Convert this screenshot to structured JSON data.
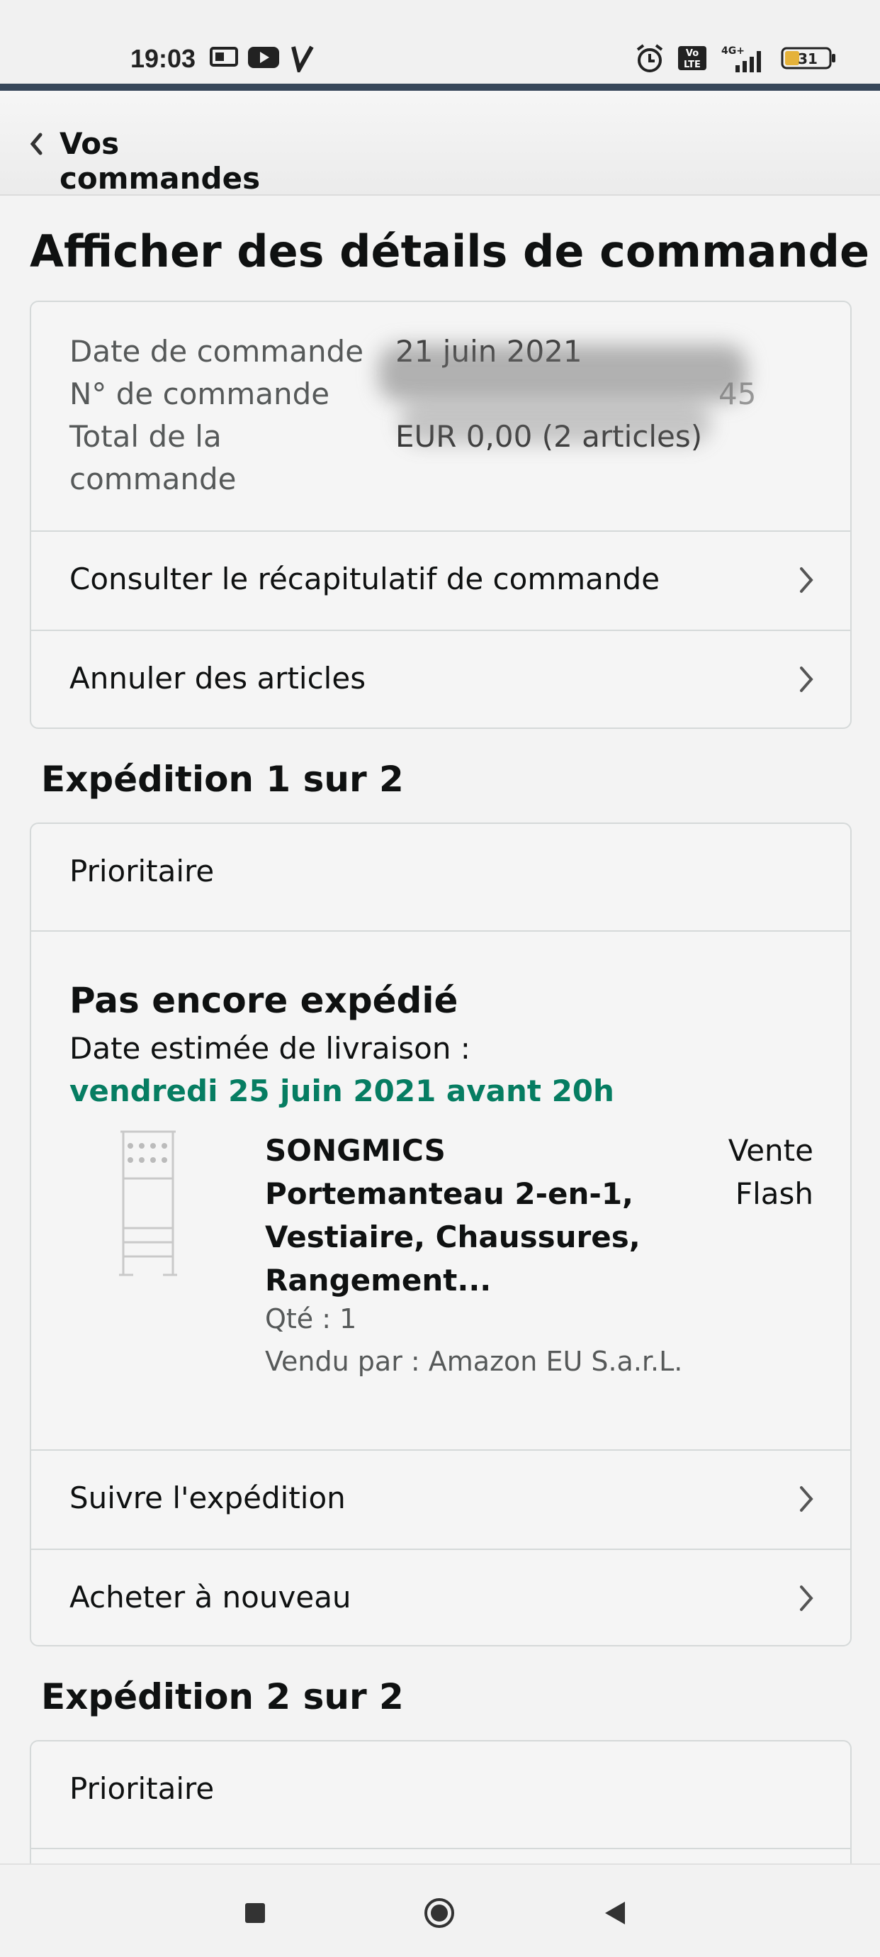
{
  "status_bar": {
    "time": "19:03",
    "battery": "31",
    "network": "4G+"
  },
  "header": {
    "back_label": "Vos commandes"
  },
  "page_title": "Afficher des détails de commande",
  "order_info": {
    "date_label": "Date de commande",
    "date_value": "21 juin 2021",
    "number_label": "N° de commande",
    "number_value": "45",
    "total_label_line1": "Total de la",
    "total_label_line2": "commande",
    "total_value": "EUR 0,00 (2 articles)"
  },
  "actions": {
    "summary": "Consulter le récapitulatif de commande",
    "cancel": "Annuler des articles"
  },
  "shipment1": {
    "title": "Expédition 1 sur 2",
    "priority": "Prioritaire",
    "status": "Pas encore expédié",
    "estimate_label": "Date estimée de livraison :",
    "estimate_date": "vendredi 25 juin 2021 avant 20h",
    "product_title_1": "SONGMICS",
    "product_title_2": "Portemanteau 2-en-1,",
    "product_title_3": "Vestiaire, Chaussures,",
    "product_title_4": "Rangement...",
    "deal_1": "Vente",
    "deal_2": "Flash",
    "qty": "Qté : 1",
    "seller": "Vendu par : Amazon EU S.a.r.L.",
    "track": "Suivre l'expédition",
    "buy_again": "Acheter à nouveau"
  },
  "shipment2": {
    "title": "Expédition 2 sur 2",
    "priority": "Prioritaire"
  },
  "colors": {
    "accent_green": "#067d62",
    "status_line": "#37475a"
  }
}
